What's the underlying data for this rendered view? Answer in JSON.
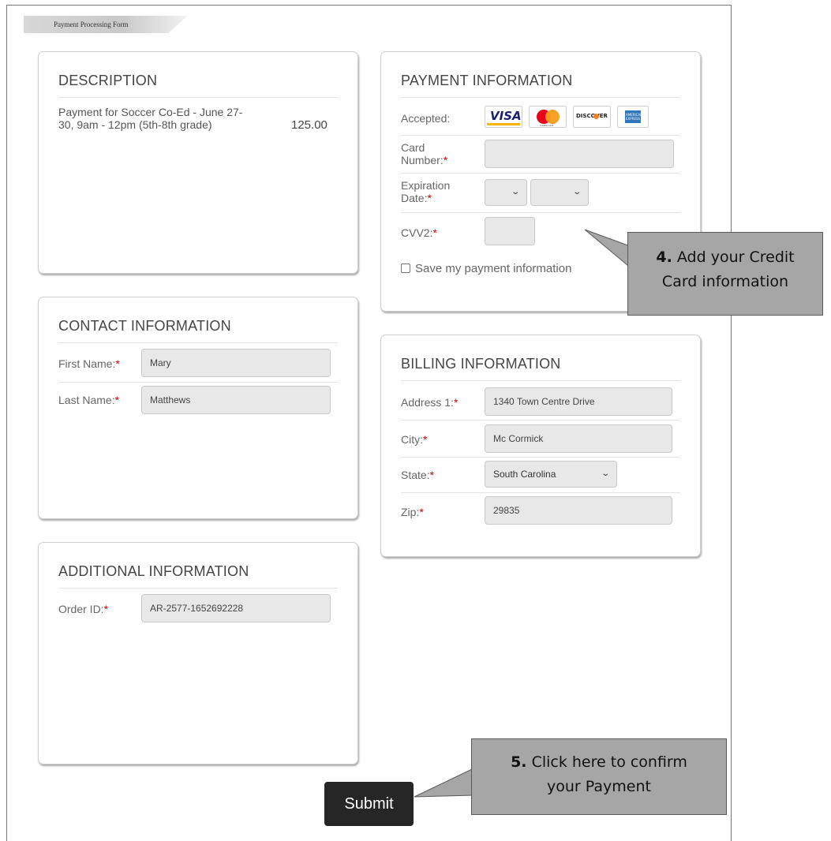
{
  "header": {
    "tab_label": "Payment Processing Form"
  },
  "description": {
    "title": "DESCRIPTION",
    "item_text": "Payment for Soccer Co-Ed - June 27-30, 9am - 12pm (5th-8th grade)",
    "item_amount": "125.00"
  },
  "contact": {
    "title": "CONTACT INFORMATION",
    "first_name_label": "First Name:",
    "first_name_value": "Mary",
    "last_name_label": "Last Name:",
    "last_name_value": "Matthews",
    "required_mark": "*"
  },
  "additional": {
    "title": "ADDITIONAL INFORMATION",
    "order_id_label": "Order ID:",
    "order_id_value": "AR-2577-1652692228",
    "required_mark": "*"
  },
  "payment": {
    "title": "PAYMENT INFORMATION",
    "accepted_label": "Accepted:",
    "cards": [
      "VISA",
      "mastercard",
      "DISCOVER",
      "AMERICAN EXPRESS"
    ],
    "card_number_label_1": "Card",
    "card_number_label_2": "Number:",
    "expiration_label_1": "Expiration",
    "expiration_label_2": "Date:",
    "cvv_label": "CVV2:",
    "required_mark": "*",
    "save_label": "Save my payment information"
  },
  "billing": {
    "title": "BILLING INFORMATION",
    "address_label": "Address 1:",
    "address_value": "1340 Town Centre Drive",
    "city_label": "City:",
    "city_value": "Mc Cormick",
    "state_label": "State:",
    "state_value": "South Carolina",
    "zip_label": "Zip:",
    "zip_value": "29835",
    "required_mark": "*"
  },
  "submit": {
    "label": "Submit"
  },
  "callouts": {
    "step4_number": "4.",
    "step4_text_1": " Add your Credit",
    "step4_text_2": "Card information",
    "step5_number": "5.",
    "step5_text_1": " Click here to confirm",
    "step5_text_2": "your Payment"
  },
  "colors": {
    "required": "#d10000",
    "submit_bg": "#262626",
    "callout_bg": "#a6a6a6"
  },
  "icons": {
    "select_arrow": "chevron-down-icon",
    "checkbox": "checkbox-icon"
  }
}
